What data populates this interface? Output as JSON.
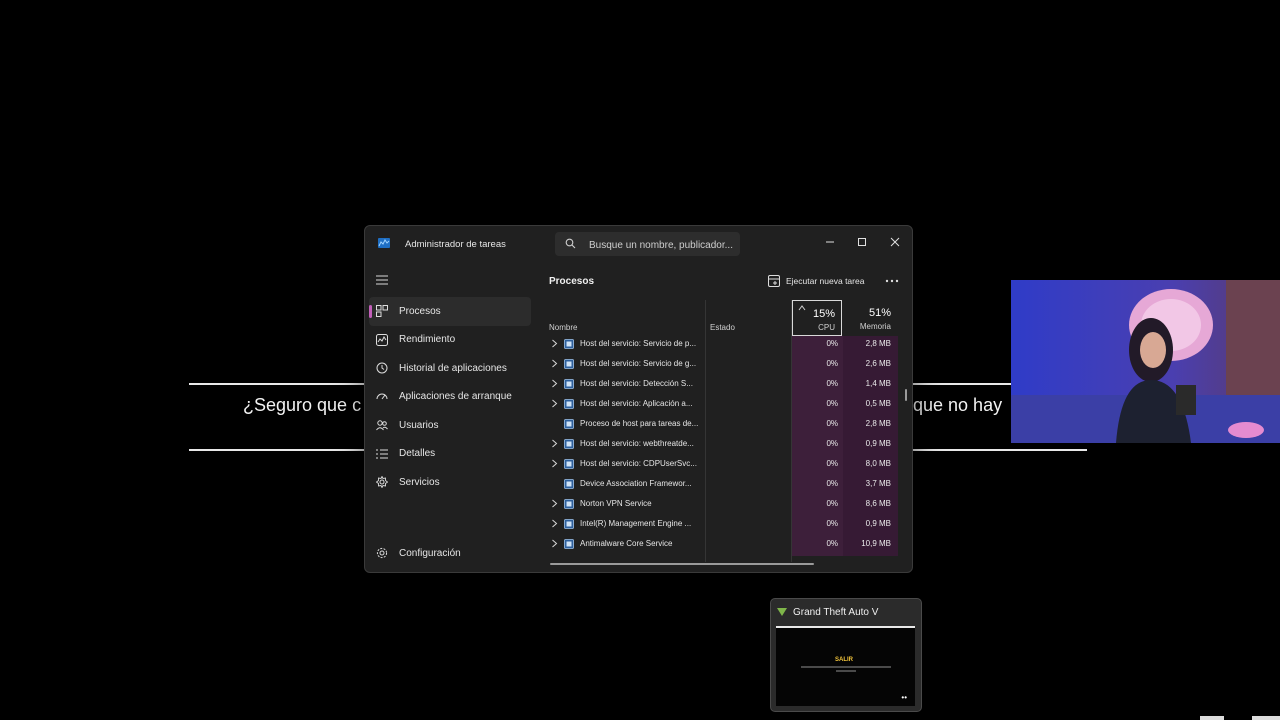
{
  "background_dialog": {
    "text_left": "¿Seguro que c",
    "text_right": "que no hay"
  },
  "window": {
    "title": "Administrador de tareas",
    "search_placeholder": "Busque un nombre, publicador..."
  },
  "sidebar": {
    "items": [
      {
        "label": "Procesos",
        "icon": "processes-icon",
        "active": true
      },
      {
        "label": "Rendimiento",
        "icon": "performance-icon"
      },
      {
        "label": "Historial de aplicaciones",
        "icon": "history-icon"
      },
      {
        "label": "Aplicaciones de arranque",
        "icon": "startup-icon"
      },
      {
        "label": "Usuarios",
        "icon": "users-icon"
      },
      {
        "label": "Detalles",
        "icon": "details-icon"
      },
      {
        "label": "Servicios",
        "icon": "services-icon"
      }
    ],
    "settings_label": "Configuración"
  },
  "main": {
    "title": "Procesos",
    "run_task_label": "Ejecutar nueva tarea",
    "columns": {
      "name": "Nombre",
      "status": "Estado",
      "cpu_pct": "15%",
      "cpu_label": "CPU",
      "mem_pct": "51%",
      "mem_label": "Memoria"
    },
    "rows": [
      {
        "name": "Host del servicio: Servicio de p...",
        "cpu": "0%",
        "mem": "2,8 MB",
        "expandable": true
      },
      {
        "name": "Host del servicio: Servicio de g...",
        "cpu": "0%",
        "mem": "2,6 MB",
        "expandable": true
      },
      {
        "name": "Host del servicio: Detección S...",
        "cpu": "0%",
        "mem": "1,4 MB",
        "expandable": true
      },
      {
        "name": "Host del servicio: Aplicación a...",
        "cpu": "0%",
        "mem": "0,5 MB",
        "expandable": true
      },
      {
        "name": "Proceso de host para tareas de...",
        "cpu": "0%",
        "mem": "2,8 MB",
        "expandable": false
      },
      {
        "name": "Host del servicio: webthreatde...",
        "cpu": "0%",
        "mem": "0,9 MB",
        "expandable": true
      },
      {
        "name": "Host del servicio: CDPUserSvc...",
        "cpu": "0%",
        "mem": "8,0 MB",
        "expandable": true
      },
      {
        "name": "Device Association Framewor...",
        "cpu": "0%",
        "mem": "3,7 MB",
        "expandable": false
      },
      {
        "name": "Norton VPN Service",
        "cpu": "0%",
        "mem": "8,6 MB",
        "expandable": true
      },
      {
        "name": "Intel(R) Management Engine ...",
        "cpu": "0%",
        "mem": "0,9 MB",
        "expandable": true
      },
      {
        "name": "Antimalware Core Service",
        "cpu": "0%",
        "mem": "10,9 MB",
        "expandable": true
      }
    ]
  },
  "thumbnail": {
    "title": "Grand Theft Auto V",
    "preview_text": "SALIR"
  },
  "colors": {
    "accent": "#c25fb9",
    "window_bg": "#202020",
    "cpu_column": "#3d1f3a"
  }
}
